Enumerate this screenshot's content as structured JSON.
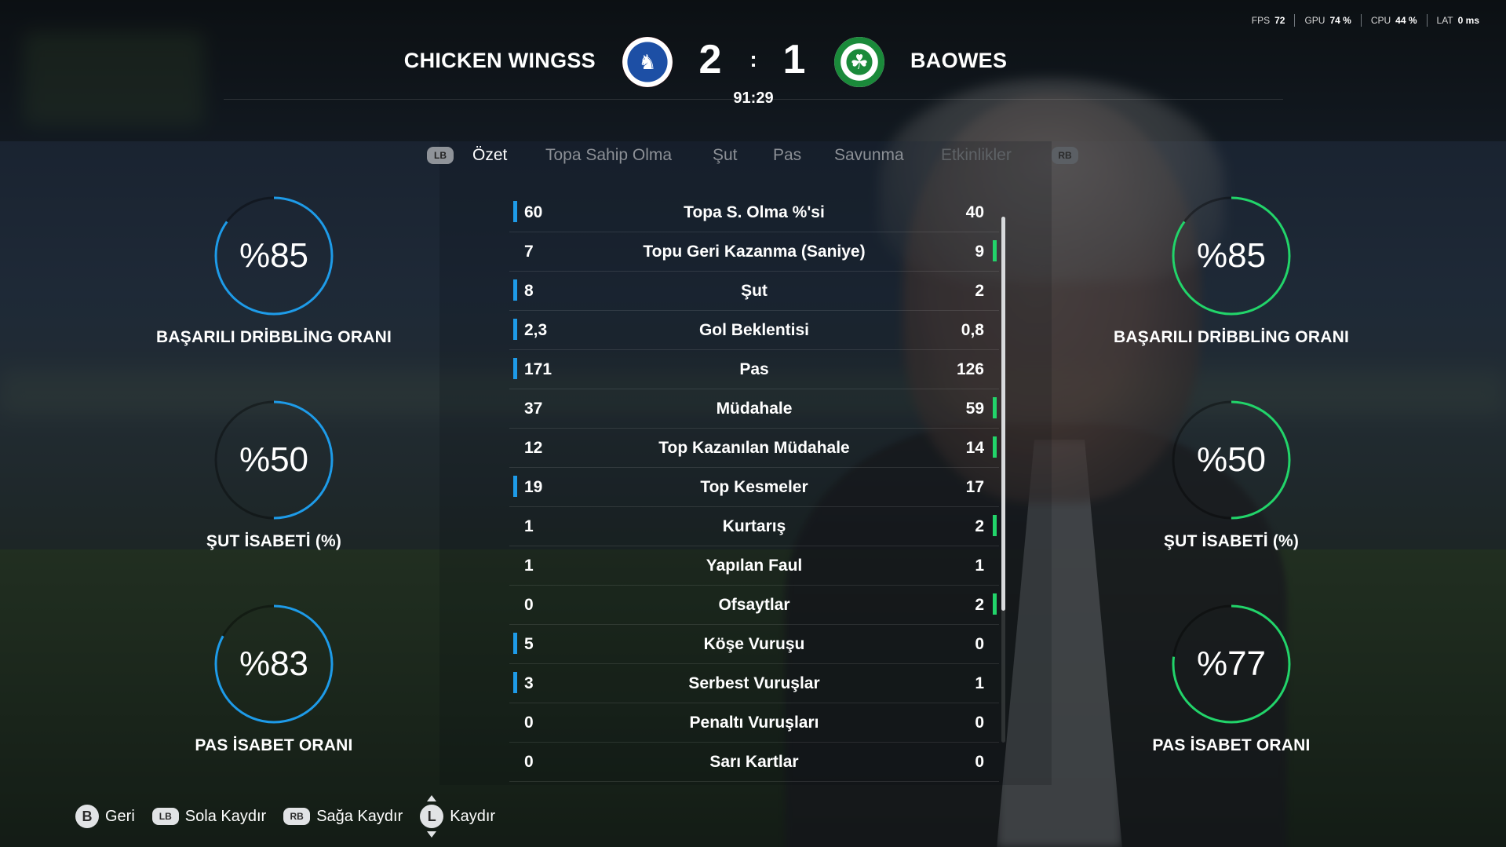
{
  "hud": {
    "fps_label": "FPS",
    "fps_value": "72",
    "gpu_label": "GPU",
    "gpu_value": "74 %",
    "cpu_label": "CPU",
    "cpu_value": "44 %",
    "lat_label": "LAT",
    "lat_value": "0 ms"
  },
  "match": {
    "home_team": "CHICKEN WINGSS",
    "away_team": "BAOWES",
    "home_score": "2",
    "separator": ":",
    "away_score": "1",
    "clock": "91:29",
    "home_color": "#1d4fa5",
    "away_color": "#1a8a3a"
  },
  "tabs": {
    "lb": "LB",
    "rb": "RB",
    "items": [
      "Özet",
      "Topa Sahip Olma",
      "Şut",
      "Pas",
      "Savunma",
      "Etkinlikler"
    ],
    "active": "Özet"
  },
  "home_rings": [
    {
      "value": "%85",
      "label": "BAŞARILI DRİBBLİNG ORANI",
      "percent": 85
    },
    {
      "value": "%50",
      "label": "ŞUT İSABETİ (%)",
      "percent": 50
    },
    {
      "value": "%83",
      "label": "PAS İSABET ORANI",
      "percent": 83
    }
  ],
  "away_rings": [
    {
      "value": "%85",
      "label": "BAŞARILI DRİBBLİNG ORANI",
      "percent": 85
    },
    {
      "value": "%50",
      "label": "ŞUT İSABETİ (%)",
      "percent": 50
    },
    {
      "value": "%77",
      "label": "PAS İSABET ORANI",
      "percent": 77
    }
  ],
  "colors": {
    "home_accent": "#1e9be8",
    "away_accent": "#22d46a"
  },
  "stats": [
    {
      "label": "Topa S. Olma %'si",
      "home": "60",
      "away": "40",
      "leader": "home"
    },
    {
      "label": "Topu Geri Kazanma (Saniye)",
      "home": "7",
      "away": "9",
      "leader": "away"
    },
    {
      "label": "Şut",
      "home": "8",
      "away": "2",
      "leader": "home"
    },
    {
      "label": "Gol Beklentisi",
      "home": "2,3",
      "away": "0,8",
      "leader": "home"
    },
    {
      "label": "Pas",
      "home": "171",
      "away": "126",
      "leader": "home"
    },
    {
      "label": "Müdahale",
      "home": "37",
      "away": "59",
      "leader": "away"
    },
    {
      "label": "Top Kazanılan Müdahale",
      "home": "12",
      "away": "14",
      "leader": "away"
    },
    {
      "label": "Top Kesmeler",
      "home": "19",
      "away": "17",
      "leader": "home"
    },
    {
      "label": "Kurtarış",
      "home": "1",
      "away": "2",
      "leader": "away"
    },
    {
      "label": "Yapılan Faul",
      "home": "1",
      "away": "1",
      "leader": "none"
    },
    {
      "label": "Ofsaytlar",
      "home": "0",
      "away": "2",
      "leader": "away"
    },
    {
      "label": "Köşe Vuruşu",
      "home": "5",
      "away": "0",
      "leader": "home"
    },
    {
      "label": "Serbest Vuruşlar",
      "home": "3",
      "away": "1",
      "leader": "home"
    },
    {
      "label": "Penaltı Vuruşları",
      "home": "0",
      "away": "0",
      "leader": "none"
    },
    {
      "label": "Sarı Kartlar",
      "home": "0",
      "away": "0",
      "leader": "none"
    }
  ],
  "footer": {
    "back_button": "B",
    "back_label": "Geri",
    "lb_button": "LB",
    "left_label": "Sola Kaydır",
    "rb_button": "RB",
    "right_label": "Sağa Kaydır",
    "stick_button": "L",
    "scroll_label": "Kaydır"
  }
}
